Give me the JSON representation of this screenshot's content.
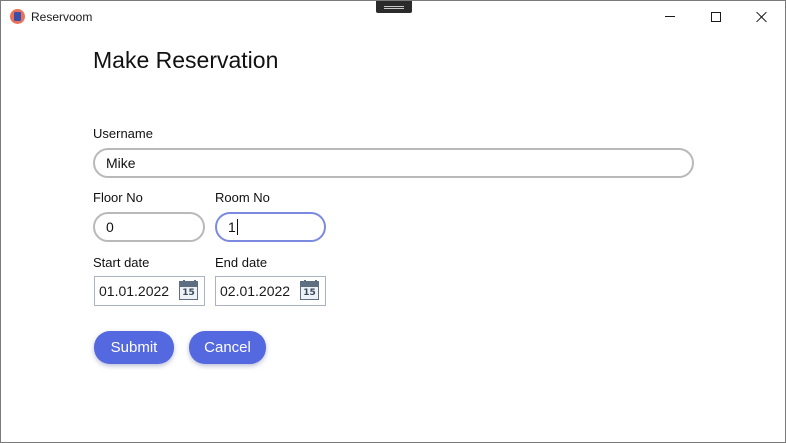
{
  "window": {
    "title": "Reservoom",
    "icon": "app-logo-icon"
  },
  "form": {
    "heading": "Make Reservation",
    "username": {
      "label": "Username",
      "value": "Mike"
    },
    "floor": {
      "label": "Floor No",
      "value": "0"
    },
    "room": {
      "label": "Room No",
      "value": "1"
    },
    "start_date": {
      "label": "Start date",
      "value": "01.01.2022",
      "icon_day": "15"
    },
    "end_date": {
      "label": "End date",
      "value": "02.01.2022",
      "icon_day": "15"
    },
    "submit_label": "Submit",
    "cancel_label": "Cancel"
  },
  "colors": {
    "accent": "#5468e0",
    "focus_border": "#7b8ae0",
    "input_border": "#b9b9b9"
  }
}
